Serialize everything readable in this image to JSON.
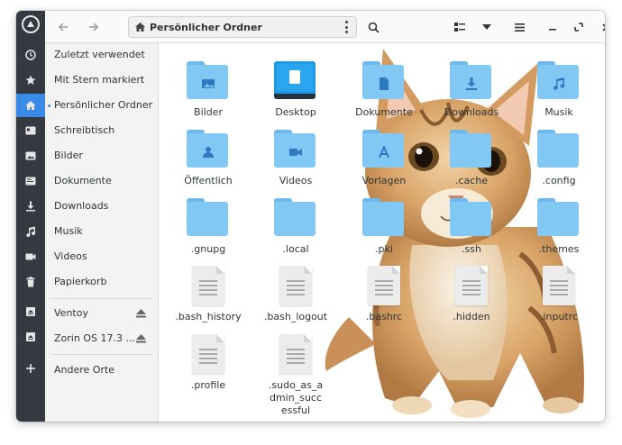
{
  "header": {
    "path_label": "Persönlicher Ordner"
  },
  "sidebar": {
    "items": [
      {
        "label": "Zuletzt verwendet",
        "icon": "clock-icon"
      },
      {
        "label": "Mit Stern markiert",
        "icon": "star-icon"
      },
      {
        "label": "Persönlicher Ordner",
        "icon": "home-icon",
        "active": true
      },
      {
        "label": "Schreibtisch",
        "icon": "desktop-icon"
      },
      {
        "label": "Bilder",
        "icon": "image-icon"
      },
      {
        "label": "Dokumente",
        "icon": "document-icon"
      },
      {
        "label": "Downloads",
        "icon": "download-icon"
      },
      {
        "label": "Musik",
        "icon": "music-icon"
      },
      {
        "label": "Videos",
        "icon": "video-icon"
      },
      {
        "label": "Papierkorb",
        "icon": "trash-icon"
      }
    ],
    "drives": [
      {
        "label": "Ventoy",
        "icon": "drive-icon"
      },
      {
        "label": "Zorin OS 17.3 ...",
        "icon": "drive-icon"
      }
    ],
    "other": {
      "label": "Andere Orte",
      "icon": "plus-icon"
    }
  },
  "files": [
    {
      "name": "Bilder",
      "type": "folder",
      "emblem": "image-icon"
    },
    {
      "name": "Desktop",
      "type": "desktop"
    },
    {
      "name": "Dokumente",
      "type": "folder",
      "emblem": "document-icon"
    },
    {
      "name": "Downloads",
      "type": "folder",
      "emblem": "download-icon"
    },
    {
      "name": "Musik",
      "type": "folder",
      "emblem": "music-icon"
    },
    {
      "name": "Öffentlich",
      "type": "folder",
      "emblem": "user-icon"
    },
    {
      "name": "Videos",
      "type": "folder",
      "emblem": "video-icon"
    },
    {
      "name": "Vorlagen",
      "type": "folder",
      "emblem": "template-icon"
    },
    {
      "name": ".cache",
      "type": "folder"
    },
    {
      "name": ".config",
      "type": "folder"
    },
    {
      "name": ".gnupg",
      "type": "folder"
    },
    {
      "name": ".local",
      "type": "folder"
    },
    {
      "name": ".pki",
      "type": "folder"
    },
    {
      "name": ".ssh",
      "type": "folder"
    },
    {
      "name": ".themes",
      "type": "folder"
    },
    {
      "name": ".bash_history",
      "type": "text"
    },
    {
      "name": ".bash_logout",
      "type": "text"
    },
    {
      "name": ".bashrc",
      "type": "text"
    },
    {
      "name": ".hidden",
      "type": "text"
    },
    {
      "name": ".inputrc",
      "type": "text"
    },
    {
      "name": ".profile",
      "type": "text"
    },
    {
      "name": ".sudo_as_admin_successful",
      "type": "text"
    }
  ],
  "colors": {
    "rail": "#353a42",
    "accent": "#3a8be6",
    "folder": "#82c8f4"
  }
}
